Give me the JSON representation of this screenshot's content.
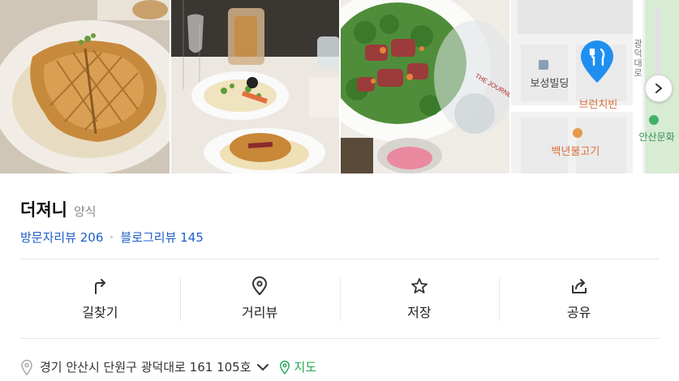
{
  "place": {
    "name": "더져니",
    "category": "양식",
    "visitor_reviews": "방문자리뷰 206",
    "blog_reviews": "블로그리뷰 145"
  },
  "photos": [
    {
      "label": "pie-crust dish photo"
    },
    {
      "label": "table with dishes photo"
    },
    {
      "label": "steak salad photo"
    },
    {
      "label": "map thumbnail"
    }
  ],
  "map": {
    "pois": [
      "보성빌딩",
      "브런치빈",
      "백년불고기",
      "안산문화"
    ],
    "road": "광덕대로",
    "plate_text": "THE JOURNEY"
  },
  "actions": [
    {
      "label": "길찾기"
    },
    {
      "label": "거리뷰"
    },
    {
      "label": "저장"
    },
    {
      "label": "공유"
    }
  ],
  "address": {
    "text": "경기 안산시 단원구 광덕대로 161 105호",
    "map_link": "지도"
  },
  "colors": {
    "link_blue": "#1f5ec9",
    "map_green": "#1fa84f",
    "marker_blue": "#1e8ff0"
  }
}
